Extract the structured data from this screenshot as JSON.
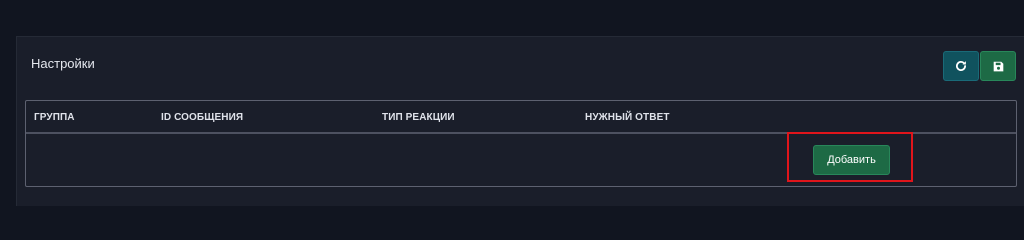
{
  "panel": {
    "title": "Настройки"
  },
  "toolbar": {
    "refresh_icon": "refresh-icon",
    "save_icon": "save-icon",
    "refresh_color": "#10525e",
    "save_color": "#1d6a45"
  },
  "table": {
    "columns": [
      "ГРУППА",
      "ID СООБЩЕНИЯ",
      "ТИП РЕАКЦИИ",
      "НУЖНЫЙ ОТВЕТ"
    ],
    "rows": [],
    "add_button_label": "Добавить"
  },
  "highlight_color": "#e0151b"
}
